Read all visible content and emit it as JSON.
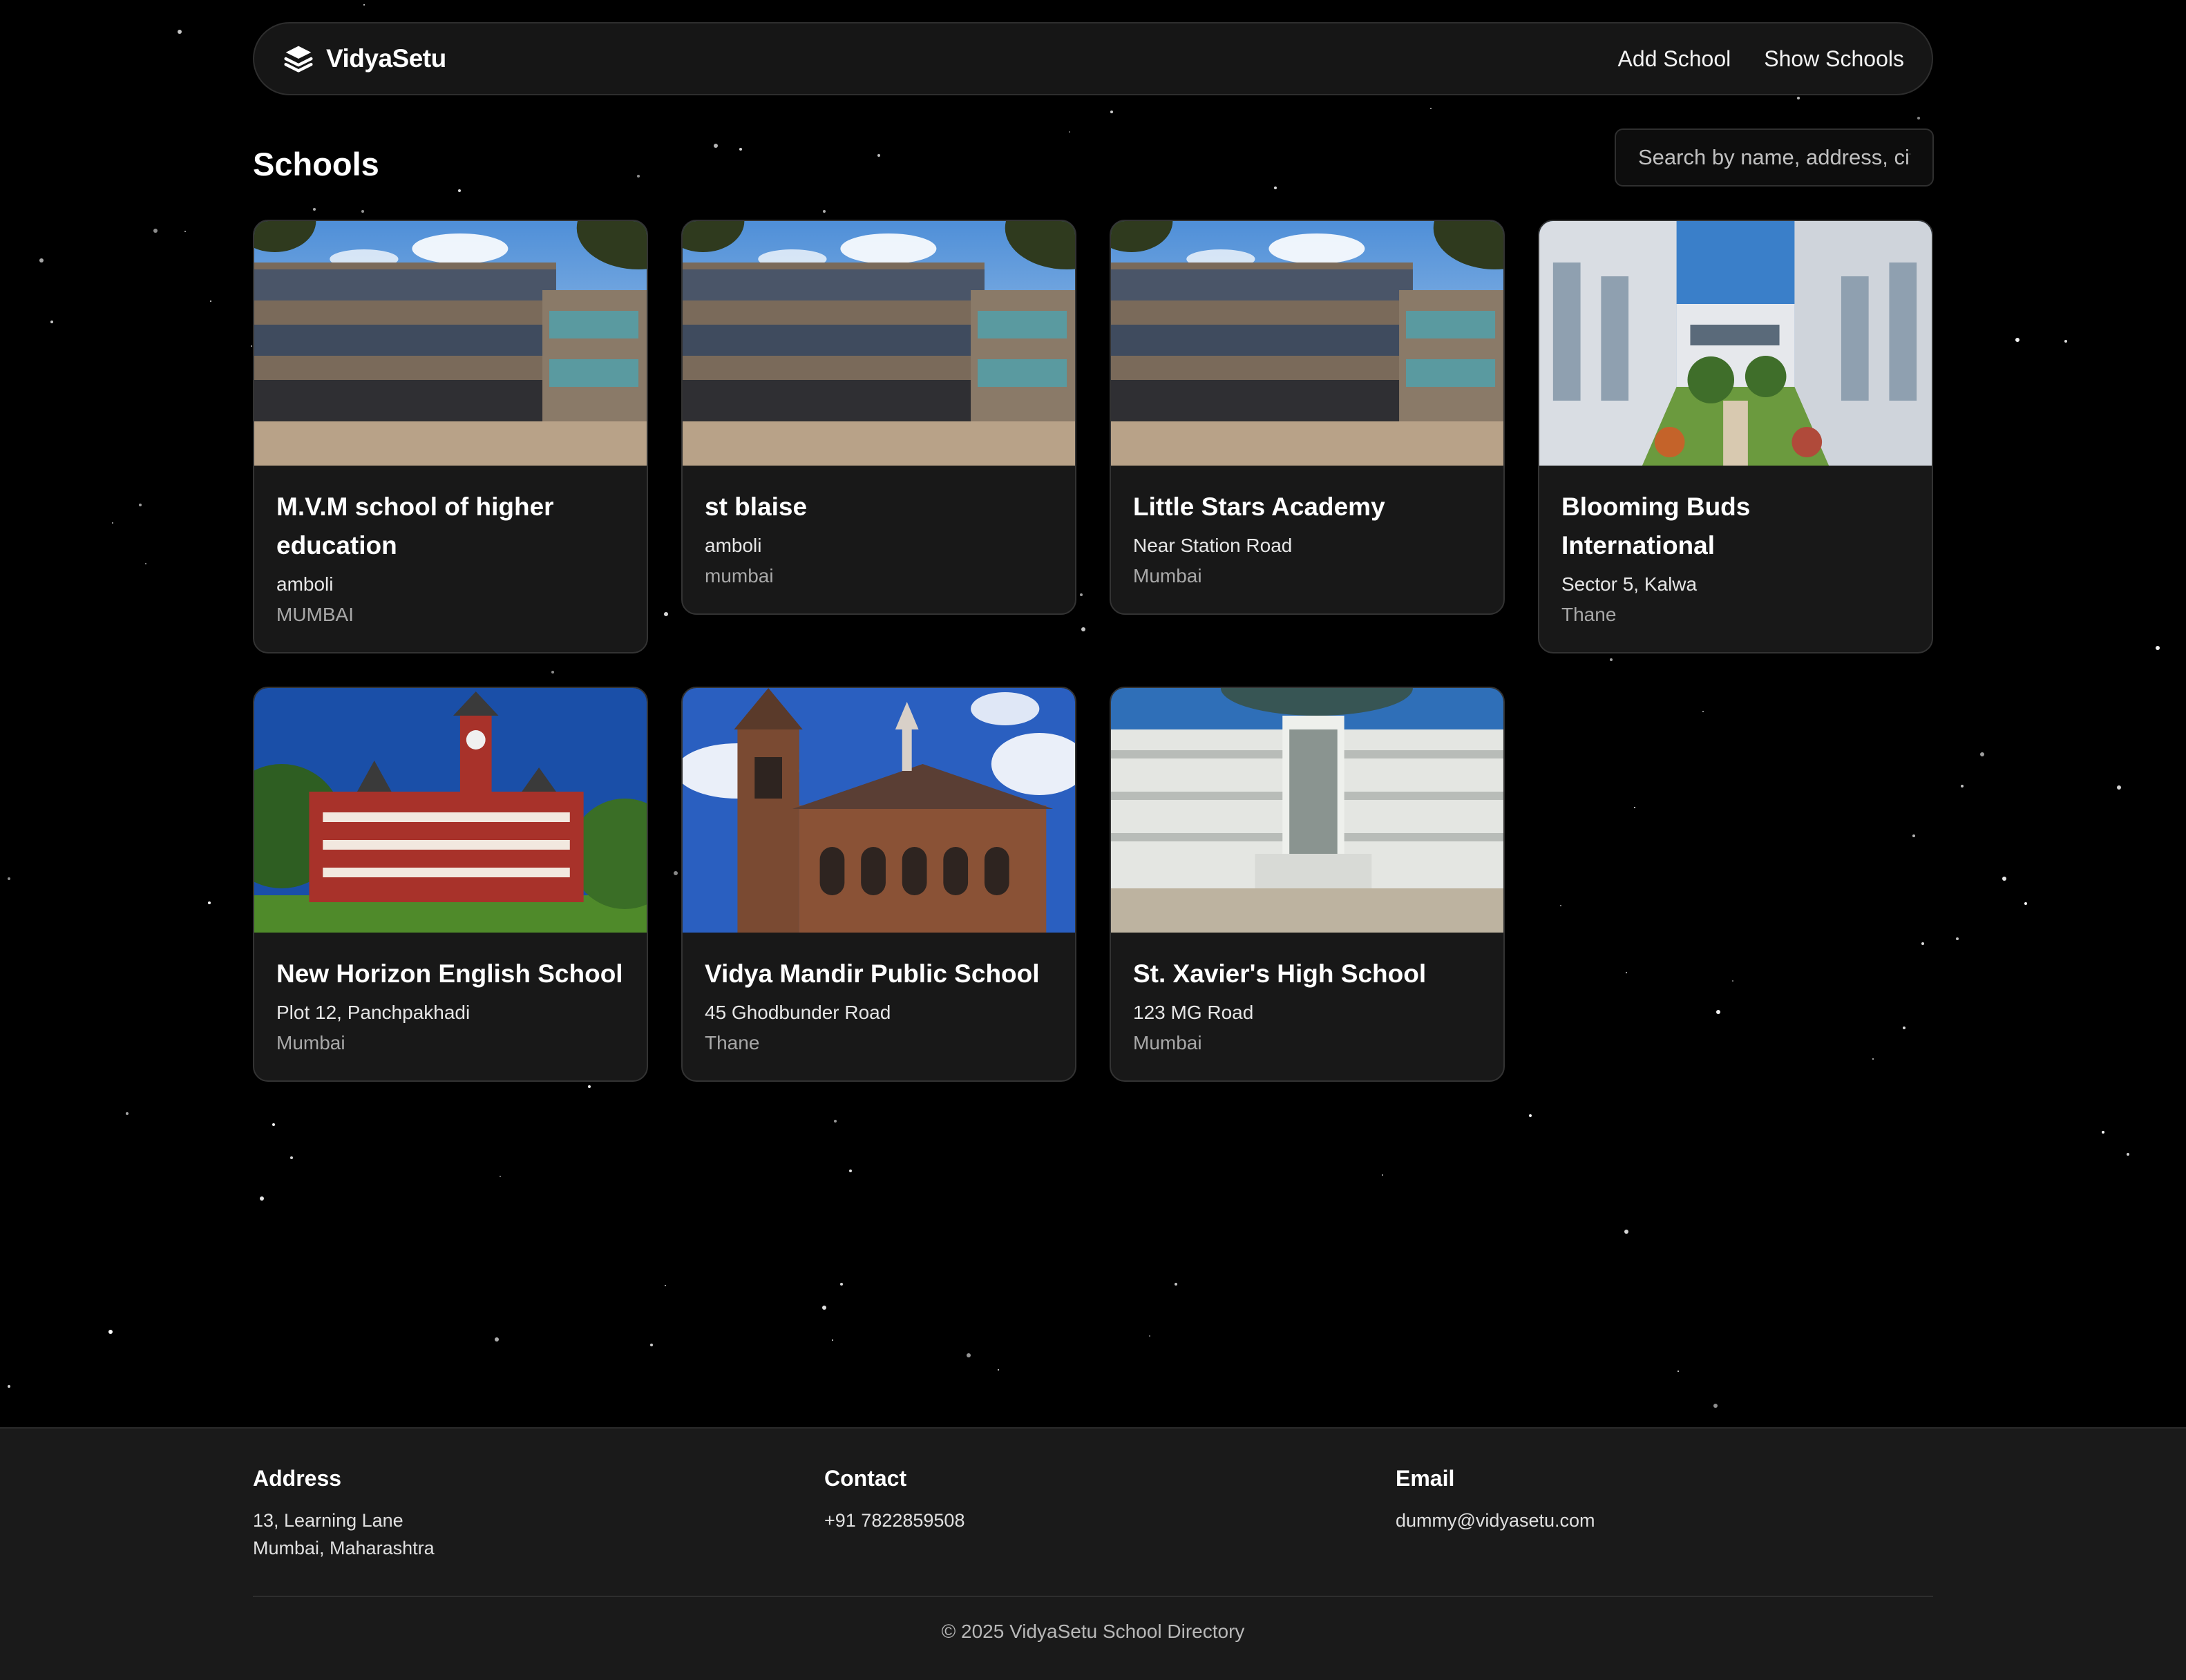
{
  "brand": {
    "name": "VidyaSetu",
    "logo_icon": "layers-icon"
  },
  "nav": {
    "add_school": "Add School",
    "show_schools": "Show Schools"
  },
  "page": {
    "title": "Schools"
  },
  "search": {
    "placeholder": "Search by name, address, city..."
  },
  "schools": [
    {
      "name": "M.V.M school of higher education",
      "address": "amboli",
      "city": "MUMBAI",
      "image": "modern-school-building"
    },
    {
      "name": "st blaise",
      "address": "amboli",
      "city": "mumbai",
      "image": "modern-school-building"
    },
    {
      "name": "Little Stars Academy",
      "address": "Near Station Road",
      "city": "Mumbai",
      "image": "modern-school-building"
    },
    {
      "name": "Blooming Buds International",
      "address": "Sector 5, Kalwa",
      "city": "Thane",
      "image": "courtyard-building"
    },
    {
      "name": "New Horizon English School",
      "address": "Plot 12, Panchpakhadi",
      "city": "Mumbai",
      "image": "red-clocktower-building"
    },
    {
      "name": "Vidya Mandir Public School",
      "address": "45 Ghodbunder Road",
      "city": "Thane",
      "image": "brick-gothic-building"
    },
    {
      "name": "St. Xavier's High School",
      "address": "123 MG Road",
      "city": "Mumbai",
      "image": "white-school-building"
    }
  ],
  "footer": {
    "address": {
      "heading": "Address",
      "line1": "13, Learning Lane",
      "line2": "Mumbai, Maharashtra"
    },
    "contact": {
      "heading": "Contact",
      "phone": "+91 7822859508"
    },
    "email": {
      "heading": "Email",
      "value": "dummy@vidyasetu.com"
    },
    "copyright": "© 2025 VidyaSetu School Directory"
  },
  "colors": {
    "background": "#000000",
    "surface": "#181818",
    "border": "#333333",
    "text": "#ffffff",
    "muted": "#a8a8a8"
  }
}
